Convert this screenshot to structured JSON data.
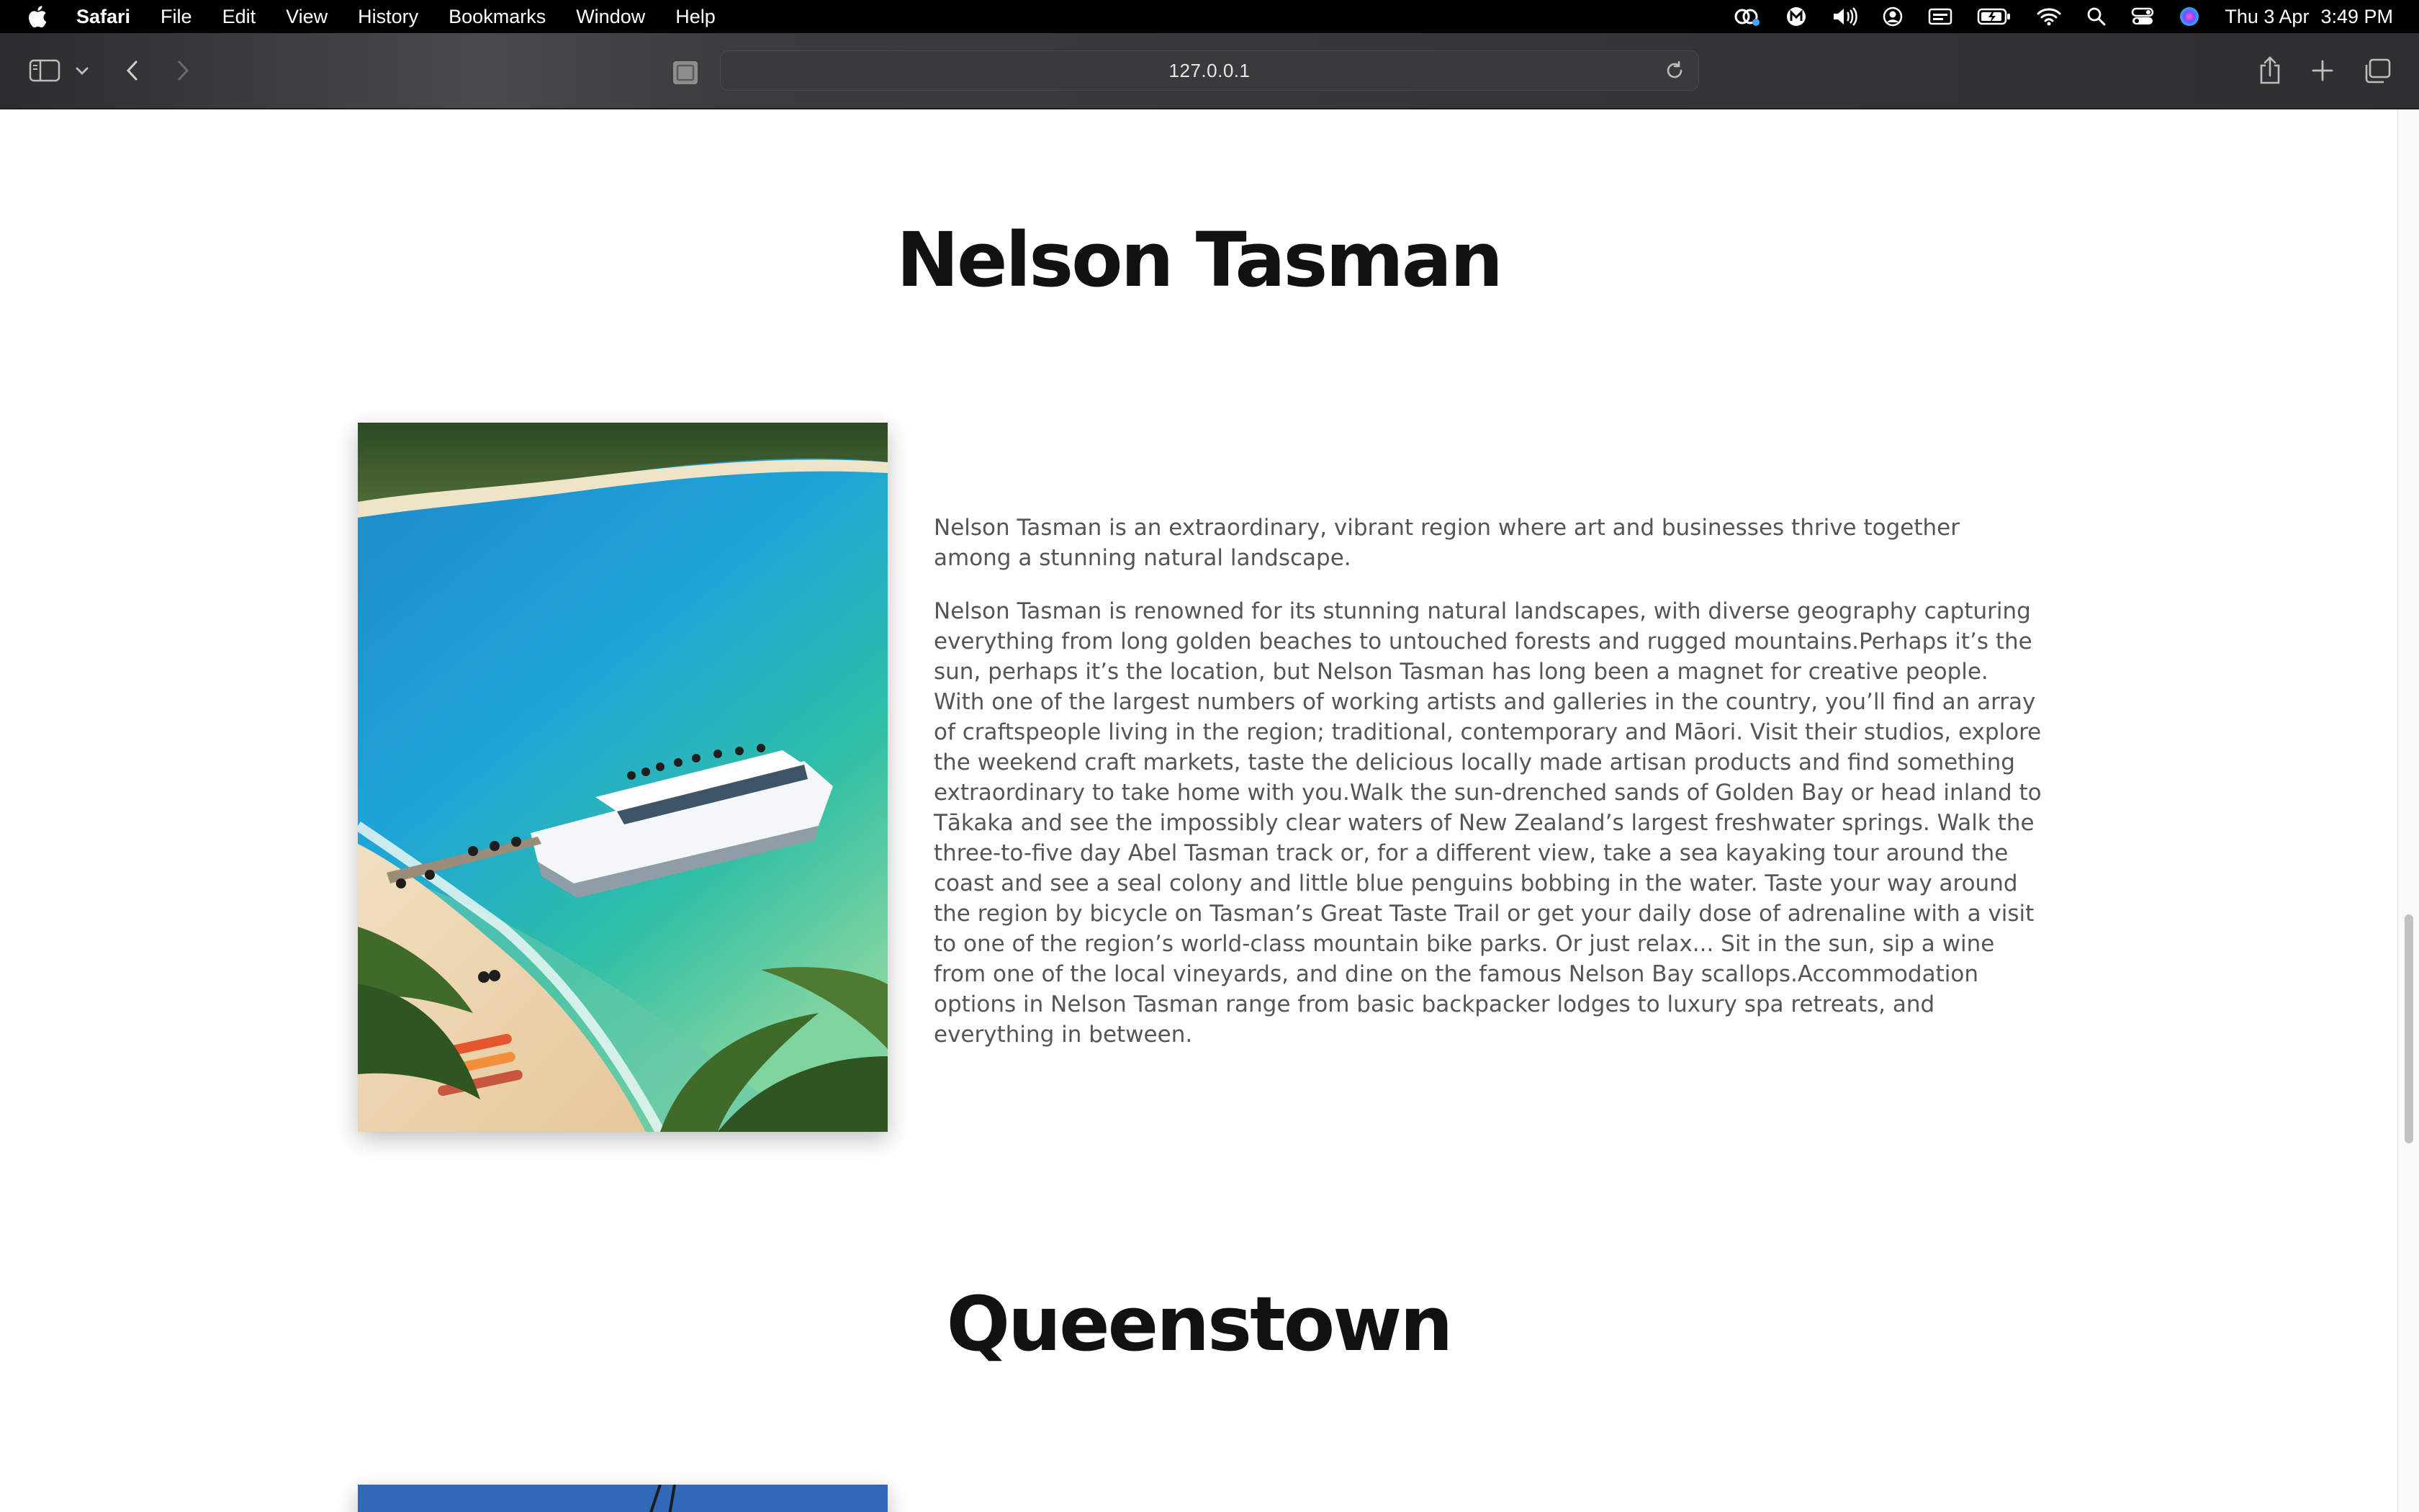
{
  "menubar": {
    "app_name": "Safari",
    "items": [
      "File",
      "Edit",
      "View",
      "History",
      "Bookmarks",
      "Window",
      "Help"
    ],
    "date": "Thu 3 Apr",
    "time": "3:49 PM"
  },
  "browser": {
    "url": "127.0.0.1"
  },
  "sections": [
    {
      "title": "Nelson Tasman",
      "intro": "Nelson Tasman is an extraordinary, vibrant region where art and businesses thrive together among a stunning natural landscape.",
      "body": "Nelson Tasman is renowned for its stunning natural landscapes, with diverse geography capturing everything from long golden beaches to untouched forests and rugged mountains.Perhaps it’s the sun, perhaps it’s the location, but Nelson Tasman has long been a magnet for creative people. With one of the largest numbers of working artists and galleries in the country, you’ll find an array of craftspeople living in the region; traditional, contemporary and Māori. Visit their studios, explore the weekend craft markets, taste the delicious locally made artisan products and find something extraordinary to take home with you.Walk the sun-drenched sands of Golden Bay or head inland to Tākaka and see the impossibly clear waters of New Zealand’s largest freshwater springs. Walk the three-to-five day Abel Tasman track or, for a different view, take a sea kayaking tour around the coast and see a seal colony and little blue penguins bobbing in the water. Taste your way around the region by bicycle on Tasman’s Great Taste Trail or get your daily dose of adrenaline with a visit to one of the region’s world-class mountain bike parks. Or just relax... Sit in the sun, sip a wine from one of the local vineyards, and dine on the famous Nelson Bay scallops.Accommodation options in Nelson Tasman range from basic backpacker lodges to luxury spa retreats, and everything in between."
    },
    {
      "title": "Queenstown"
    }
  ]
}
